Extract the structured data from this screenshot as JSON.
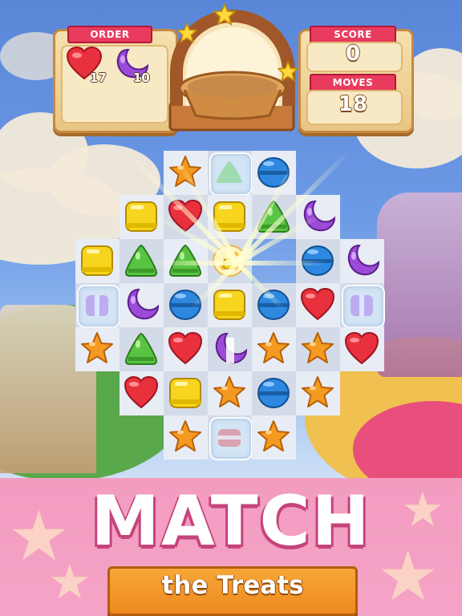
{
  "hud": {
    "order_label": "ORDER",
    "order_items": [
      {
        "icon": "heart-candy-icon",
        "count": "17"
      },
      {
        "icon": "moon-candy-icon",
        "count": "10"
      }
    ],
    "score_label": "SCORE",
    "score_value": "0",
    "moves_label": "MOVES",
    "moves_value": "18",
    "goal_icon": "pie-crust-icon"
  },
  "banner": {
    "title": "MATCH",
    "subtitle": "the Treats"
  },
  "colors": {
    "heart": "#e8313c",
    "moon": "#9b4bd8",
    "star": "#f59a20",
    "macaron": "#2e88e0",
    "square": "#f7d41e",
    "triangle": "#58c443",
    "ribbon": "#e83b5e",
    "banner": "#f29cc0",
    "sub_ribbon": "#f29a2c"
  },
  "board": {
    "rows": [
      [
        "",
        "",
        "star",
        "glass-green",
        "macaron",
        "",
        "",
        ""
      ],
      [
        "",
        "square",
        "heart",
        "square",
        "triangle",
        "moon",
        "",
        ""
      ],
      [
        "square",
        "triangle",
        "triangle",
        "bomb",
        "",
        "macaron",
        "moon",
        ""
      ],
      [
        "glass-purple",
        "moon",
        "macaron",
        "square",
        "macaron",
        "heart",
        "glass-purple",
        ""
      ],
      [
        "star",
        "triangle",
        "heart",
        "moon-half",
        "star",
        "star",
        "heart",
        ""
      ],
      [
        "",
        "heart",
        "square",
        "star",
        "macaron",
        "star",
        "",
        ""
      ],
      [
        "",
        "",
        "star",
        "glass-red",
        "star",
        "",
        "",
        ""
      ]
    ]
  }
}
